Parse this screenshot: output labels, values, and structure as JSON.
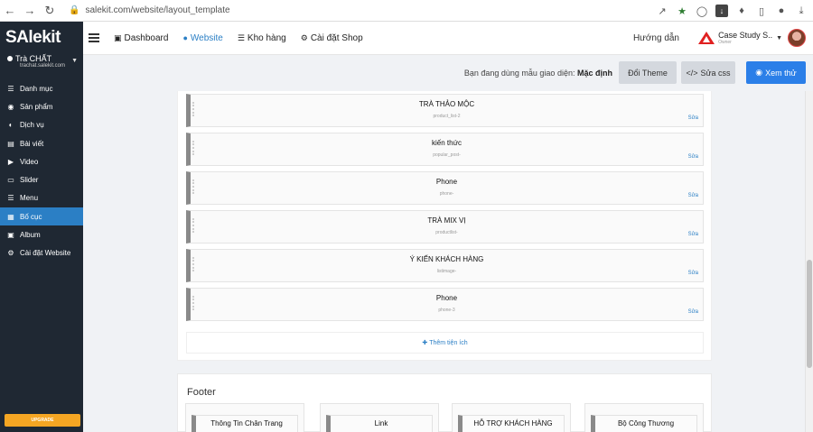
{
  "browser": {
    "url": "salekit.com/website/layout_template"
  },
  "sidebar": {
    "brand": "SAlekit",
    "store_name": "Trà CHẤT",
    "store_url": "trachat.salekit.com",
    "items": [
      {
        "label": "Danh mục",
        "icon": "list-icon",
        "active": false
      },
      {
        "label": "Sản phẩm",
        "icon": "box-icon",
        "active": false
      },
      {
        "label": "Dịch vụ",
        "icon": "service-icon",
        "active": false
      },
      {
        "label": "Bài viết",
        "icon": "article-icon",
        "active": false
      },
      {
        "label": "Video",
        "icon": "video-icon",
        "active": false
      },
      {
        "label": "Slider",
        "icon": "slider-icon",
        "active": false
      },
      {
        "label": "Menu",
        "icon": "menu-icon",
        "active": false
      },
      {
        "label": "Bố cục",
        "icon": "layout-icon",
        "active": true
      },
      {
        "label": "Album",
        "icon": "album-icon",
        "active": false
      },
      {
        "label": "Cài đặt Website",
        "icon": "gear-icon",
        "active": false
      }
    ],
    "upgrade_label": "UPGRADE"
  },
  "topbar": {
    "nav": [
      {
        "label": "Dashboard",
        "icon": "monitor-icon",
        "active": false
      },
      {
        "label": "Website",
        "icon": "globe-icon",
        "active": true
      },
      {
        "label": "Kho hàng",
        "icon": "database-icon",
        "active": false
      },
      {
        "label": "Cài đặt Shop",
        "icon": "gear-icon",
        "active": false
      }
    ],
    "guide_label": "Hướng dẫn",
    "account_name": "Case Study S...",
    "account_role": "Owner"
  },
  "actionbar": {
    "theme_note_prefix": "Bạn đang dùng mẫu giao diện:",
    "theme_name": "Mặc định",
    "change_theme_label": "Đổi Theme",
    "edit_css_label": "Sửa css",
    "preview_label": "Xem thử"
  },
  "blocks": [
    {
      "title": "TRÀ THẢO MỘC",
      "type": "product_list-2",
      "edit": "Sửa"
    },
    {
      "title": "kiến thức",
      "type": "popular_post-",
      "edit": "Sửa"
    },
    {
      "title": "Phone",
      "type": "phone-",
      "edit": "Sửa"
    },
    {
      "title": "TRÀ MIX VỊ",
      "type": "productlist-",
      "edit": "Sửa"
    },
    {
      "title": "Ý KIẾN KHÁCH HÀNG",
      "type": "listimage-",
      "edit": "Sửa"
    },
    {
      "title": "Phone",
      "type": "phone-3",
      "edit": "Sửa"
    }
  ],
  "add_widget_label": "Thêm tiện ích",
  "footer": {
    "title": "Footer",
    "columns": [
      {
        "title": "Thông Tin Chân Trang"
      },
      {
        "title": "Link"
      },
      {
        "title": "HỖ TRỢ KHÁCH HÀNG"
      },
      {
        "title": "Bộ Công Thương"
      }
    ]
  },
  "colors": {
    "sidebar_bg": "#1f2833",
    "active_blue": "#2b7fc5",
    "primary_button": "#2b7fe8",
    "upgrade": "#f5a623"
  }
}
